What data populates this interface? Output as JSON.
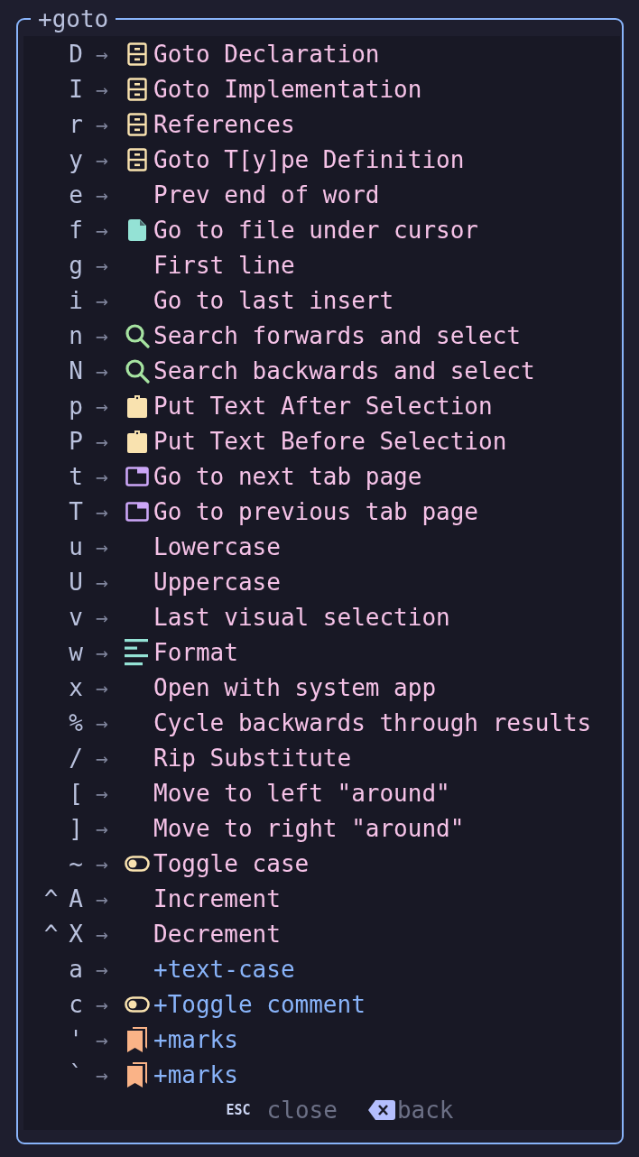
{
  "popup": {
    "title": "+goto"
  },
  "items": [
    {
      "key": "D",
      "arrow": "→",
      "kind": "drawer",
      "submenu": false,
      "label": "Goto Declaration"
    },
    {
      "key": "I",
      "arrow": "→",
      "kind": "drawer",
      "submenu": false,
      "label": "Goto Implementation"
    },
    {
      "key": "r",
      "arrow": "→",
      "kind": "drawer",
      "submenu": false,
      "label": "References"
    },
    {
      "key": "y",
      "arrow": "→",
      "kind": "drawer",
      "submenu": false,
      "label": "Goto T[y]pe Definition"
    },
    {
      "key": "e",
      "arrow": "→",
      "kind": "plain",
      "submenu": false,
      "label": "Prev end of word"
    },
    {
      "key": "f",
      "arrow": "→",
      "kind": "file",
      "submenu": false,
      "label": "Go to file under cursor"
    },
    {
      "key": "g",
      "arrow": "→",
      "kind": "plain",
      "submenu": false,
      "label": "First line"
    },
    {
      "key": "i",
      "arrow": "→",
      "kind": "plain",
      "submenu": false,
      "label": "Go to last insert"
    },
    {
      "key": "n",
      "arrow": "→",
      "kind": "search",
      "submenu": false,
      "label": "Search forwards and select"
    },
    {
      "key": "N",
      "arrow": "→",
      "kind": "search",
      "submenu": false,
      "label": "Search backwards and select"
    },
    {
      "key": "p",
      "arrow": "→",
      "kind": "clipboard",
      "submenu": false,
      "label": "Put Text After Selection"
    },
    {
      "key": "P",
      "arrow": "→",
      "kind": "clipboard",
      "submenu": false,
      "label": "Put Text Before Selection"
    },
    {
      "key": "t",
      "arrow": "→",
      "kind": "tab",
      "submenu": false,
      "label": "Go to next tab page"
    },
    {
      "key": "T",
      "arrow": "→",
      "kind": "tab",
      "submenu": false,
      "label": "Go to previous tab page"
    },
    {
      "key": "u",
      "arrow": "→",
      "kind": "plain",
      "submenu": false,
      "label": "Lowercase"
    },
    {
      "key": "U",
      "arrow": "→",
      "kind": "plain",
      "submenu": false,
      "label": "Uppercase"
    },
    {
      "key": "v",
      "arrow": "→",
      "kind": "plain",
      "submenu": false,
      "label": "Last visual selection"
    },
    {
      "key": "w",
      "arrow": "→",
      "kind": "format",
      "submenu": false,
      "label": "Format"
    },
    {
      "key": "x",
      "arrow": "→",
      "kind": "plain",
      "submenu": false,
      "label": "Open with system app"
    },
    {
      "key": "%",
      "arrow": "→",
      "kind": "plain",
      "submenu": false,
      "label": "Cycle backwards through results"
    },
    {
      "key": "/",
      "arrow": "→",
      "kind": "plain",
      "submenu": false,
      "label": "Rip Substitute"
    },
    {
      "key": "[",
      "arrow": "→",
      "kind": "plain",
      "submenu": false,
      "label": "Move to left \"around\""
    },
    {
      "key": "]",
      "arrow": "→",
      "kind": "plain",
      "submenu": false,
      "label": "Move to right \"around\""
    },
    {
      "key": "~",
      "arrow": "→",
      "kind": "toggle",
      "submenu": false,
      "label": "Toggle case"
    },
    {
      "modifier": "^",
      "key": "A",
      "arrow": "→",
      "kind": "plain",
      "submenu": false,
      "label": "Increment"
    },
    {
      "modifier": "^",
      "key": "X",
      "arrow": "→",
      "kind": "plain",
      "submenu": false,
      "label": "Decrement"
    },
    {
      "key": "a",
      "arrow": "→",
      "kind": "plain",
      "submenu": true,
      "label": "+text-case"
    },
    {
      "key": "c",
      "arrow": "→",
      "kind": "toggle",
      "submenu": true,
      "label": "+Toggle comment"
    },
    {
      "key": "'",
      "arrow": "→",
      "kind": "bookmark",
      "submenu": true,
      "label": "+marks"
    },
    {
      "key": "`",
      "arrow": "→",
      "kind": "bookmark",
      "submenu": true,
      "label": "+marks"
    }
  ],
  "footer": {
    "close_key": "ESC",
    "close_label": "close",
    "back_label": "back"
  }
}
